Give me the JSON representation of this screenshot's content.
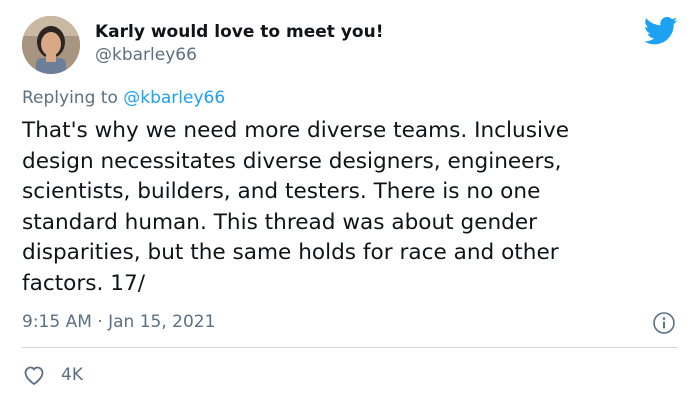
{
  "author": {
    "display_name": "Karly would love to meet you!",
    "handle": "@kbarley66",
    "avatar_icon": "profile-photo"
  },
  "platform_icon": "twitter-bird-icon",
  "reply": {
    "prefix": "Replying to",
    "mention": "@kbarley66"
  },
  "tweet": {
    "lines": [
      "That's why we need more diverse teams. Inclusive",
      "design necessitates diverse designers, engineers,",
      "scientists, builders, and testers. There is no one",
      "standard human. This thread was about gender",
      "disparities, but the same holds for race and other",
      "factors. 17/"
    ]
  },
  "meta": {
    "timestamp": "9:15 AM · Jan 15, 2021",
    "info_icon": "info-icon"
  },
  "actions": {
    "like_icon": "heart-icon",
    "like_count": "4K"
  },
  "colors": {
    "brand": "#1da1f2",
    "text": "#0f1419",
    "secondary": "#5b7083",
    "divider": "#cfd9de"
  }
}
